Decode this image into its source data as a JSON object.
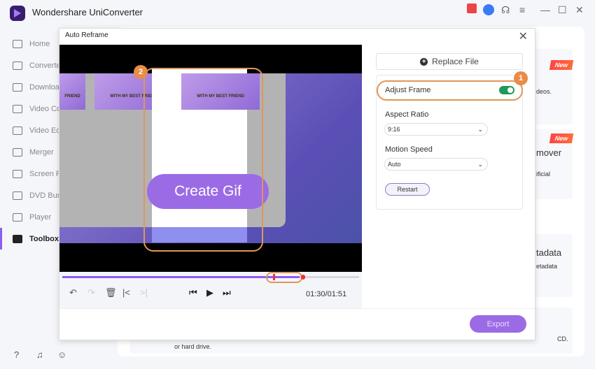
{
  "app": {
    "title": "Wondershare UniConverter",
    "controls": [
      "gift-icon",
      "account-icon",
      "support-icon",
      "menu-icon",
      "minimize-icon",
      "maximize-icon",
      "close-icon"
    ]
  },
  "sidebar": {
    "items": [
      {
        "label": "Home",
        "icon": "home-icon"
      },
      {
        "label": "Converter",
        "icon": "converter-icon"
      },
      {
        "label": "Downloader",
        "icon": "download-icon"
      },
      {
        "label": "Video Compressor",
        "icon": "compress-icon"
      },
      {
        "label": "Video Editor",
        "icon": "scissors-icon"
      },
      {
        "label": "Merger",
        "icon": "merge-icon"
      },
      {
        "label": "Screen Recorder",
        "icon": "screen-record-icon"
      },
      {
        "label": "DVD Burner",
        "icon": "dvd-icon"
      },
      {
        "label": "Player",
        "icon": "player-icon"
      },
      {
        "label": "Toolbox",
        "icon": "toolbox-icon",
        "active": true
      }
    ]
  },
  "background_cards": {
    "new_badge": "New",
    "t1": "deos.",
    "t2": "mover",
    "t3": "ificial",
    "t4": "tadata",
    "t5": "etadata",
    "t6": "or hard drive.",
    "t7": "CD."
  },
  "dialog": {
    "title": "Auto Reframe",
    "video": {
      "thumb_caption": "WITH MY BEST FRIEND",
      "thumb_caption_short": "FRIEND",
      "overlay_button": "Create Gif",
      "progress": 0.8,
      "time": "01:30/01:51"
    },
    "callouts": [
      "1",
      "2"
    ],
    "panel": {
      "replace_file": "Replace File",
      "adjust_frame": "Adjust Frame",
      "adjust_frame_on": true,
      "aspect_ratio_label": "Aspect Ratio",
      "aspect_ratio": "9:16",
      "motion_speed_label": "Motion Speed",
      "motion_speed": "Auto",
      "restart": "Restart"
    },
    "export": "Export"
  },
  "accent": "#8c5cf5"
}
